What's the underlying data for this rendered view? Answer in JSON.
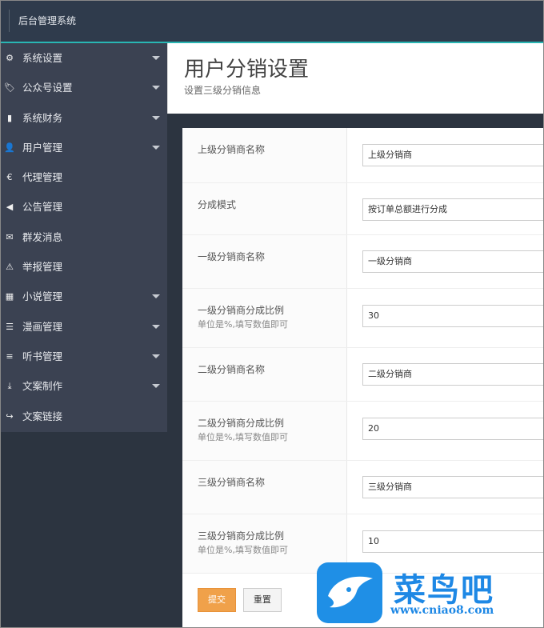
{
  "header": {
    "brand": "后台管理系统"
  },
  "sidebar": {
    "items": [
      {
        "label": "系统设置",
        "icon": "gear-icon",
        "glyph": "⚙",
        "caret": true
      },
      {
        "label": "公众号设置",
        "icon": "tag-icon",
        "glyph": "🏷",
        "caret": true
      },
      {
        "label": "系统财务",
        "icon": "bar-chart-icon",
        "glyph": "▮",
        "caret": true
      },
      {
        "label": "用户管理",
        "icon": "user-icon",
        "glyph": "👤",
        "caret": true
      },
      {
        "label": "代理管理",
        "icon": "euro-icon",
        "glyph": "€",
        "caret": false
      },
      {
        "label": "公告管理",
        "icon": "speaker-icon",
        "glyph": "◀",
        "caret": false
      },
      {
        "label": "群发消息",
        "icon": "envelope-icon",
        "glyph": "✉",
        "caret": false
      },
      {
        "label": "举报管理",
        "icon": "warning-icon",
        "glyph": "⚠",
        "caret": false
      },
      {
        "label": "小说管理",
        "icon": "grid-icon",
        "glyph": "▦",
        "caret": true
      },
      {
        "label": "漫画管理",
        "icon": "list-icon",
        "glyph": "☰",
        "caret": true
      },
      {
        "label": "听书管理",
        "icon": "equalizer-icon",
        "glyph": "≡",
        "caret": true
      },
      {
        "label": "文案制作",
        "icon": "download-icon",
        "glyph": "⤓",
        "caret": true
      },
      {
        "label": "文案链接",
        "icon": "share-icon",
        "glyph": "↪",
        "caret": false
      }
    ]
  },
  "page": {
    "title": "用户分销设置",
    "subtitle": "设置三级分销信息"
  },
  "form": {
    "rows": [
      {
        "label": "上级分销商名称",
        "hint": "",
        "value": "上级分销商"
      },
      {
        "label": "分成模式",
        "hint": "",
        "value": "按订单总额进行分成"
      },
      {
        "label": "一级分销商名称",
        "hint": "",
        "value": "一级分销商"
      },
      {
        "label": "一级分销商分成比例",
        "hint": "单位是%,填写数值即可",
        "value": "30"
      },
      {
        "label": "二级分销商名称",
        "hint": "",
        "value": "二级分销商"
      },
      {
        "label": "二级分销商分成比例",
        "hint": "单位是%,填写数值即可",
        "value": "20"
      },
      {
        "label": "三级分销商名称",
        "hint": "",
        "value": "三级分销商"
      },
      {
        "label": "三级分销商分成比例",
        "hint": "单位是%,填写数值即可",
        "value": "10"
      }
    ],
    "submit_label": "提交",
    "reset_label": "重置"
  },
  "watermark": {
    "name": "菜鸟吧",
    "url": "www.cniao8.com"
  },
  "colors": {
    "sidebar_bg": "#3b4252",
    "topbar_bg": "#2f3b4c",
    "accent_line": "#29b6b3",
    "submit_bg": "#f0a14a",
    "watermark_blue": "#1e88e5"
  }
}
